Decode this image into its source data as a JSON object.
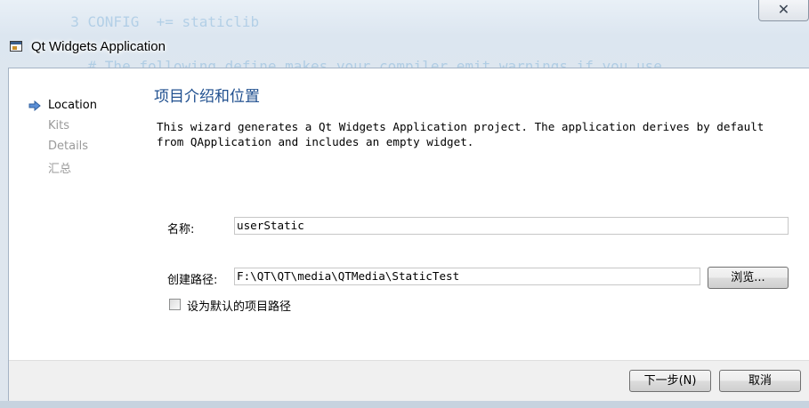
{
  "background": {
    "code_lines": [
      "  3 CONFIG  += staticlib",
      "    # The following define makes your compiler emit warnings if you use"
    ]
  },
  "window": {
    "title": "Qt Widgets Application",
    "close_glyph": "✕"
  },
  "nav": {
    "items": [
      {
        "label": "Location",
        "active": true
      },
      {
        "label": "Kits",
        "active": false
      },
      {
        "label": "Details",
        "active": false
      },
      {
        "label": "汇总",
        "active": false
      }
    ]
  },
  "page": {
    "title": "项目介绍和位置",
    "description_line1": "This wizard generates a Qt Widgets Application project. The application derives by default",
    "description_line2": "from QApplication and includes an empty widget."
  },
  "form": {
    "name_label": "名称:",
    "name_value": "userStatic",
    "path_label": "创建路径:",
    "path_value": "F:\\QT\\QT\\media\\QTMedia\\StaticTest",
    "browse_label": "浏览...",
    "default_path_label": "设为默认的项目路径",
    "default_path_checked": false
  },
  "buttons": {
    "next_label": "下一步(N)",
    "cancel_label": "取消"
  },
  "colors": {
    "accent": "#1f4f8f",
    "arrow": "#3c6fb5"
  },
  "icons": {
    "window": "app-window-icon",
    "close": "close-icon",
    "nav_current": "arrow-right-icon"
  }
}
